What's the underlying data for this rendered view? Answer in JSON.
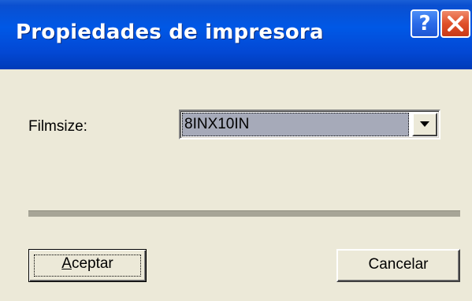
{
  "window": {
    "title": "Propiedades de impresora"
  },
  "titlebar_buttons": {
    "help_glyph": "?",
    "help_icon": "help-icon",
    "close_icon": "close-icon"
  },
  "form": {
    "filmsize_label": "Filmsize:",
    "filmsize_value": "8INX10IN"
  },
  "buttons": {
    "ok_label": "Aceptar",
    "cancel_label": "Cancelar"
  },
  "colors": {
    "titlebar": "#0058e6",
    "dialog_bg": "#ece9d8",
    "selection_bg": "#a6aab9",
    "close_button": "#e0502a"
  }
}
